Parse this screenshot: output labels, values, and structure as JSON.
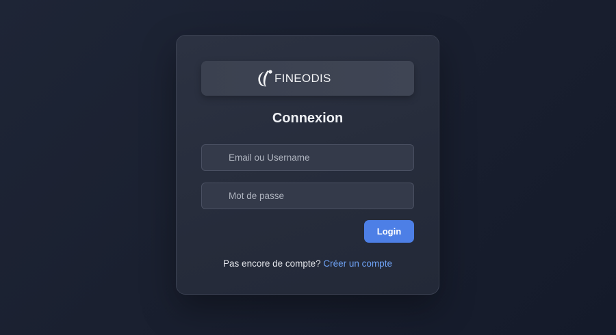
{
  "brand": {
    "name": "FINEODIS"
  },
  "login_form": {
    "title": "Connexion",
    "email_placeholder": "Email ou Username",
    "password_placeholder": "Mot de passe",
    "submit_label": "Login",
    "signup_prompt": "Pas encore de compte?",
    "signup_link": "Créer un compte"
  },
  "colors": {
    "accent": "#4d7fe6",
    "link": "#6ea2f5",
    "background": "#1a2030",
    "card": "#2a3040"
  }
}
